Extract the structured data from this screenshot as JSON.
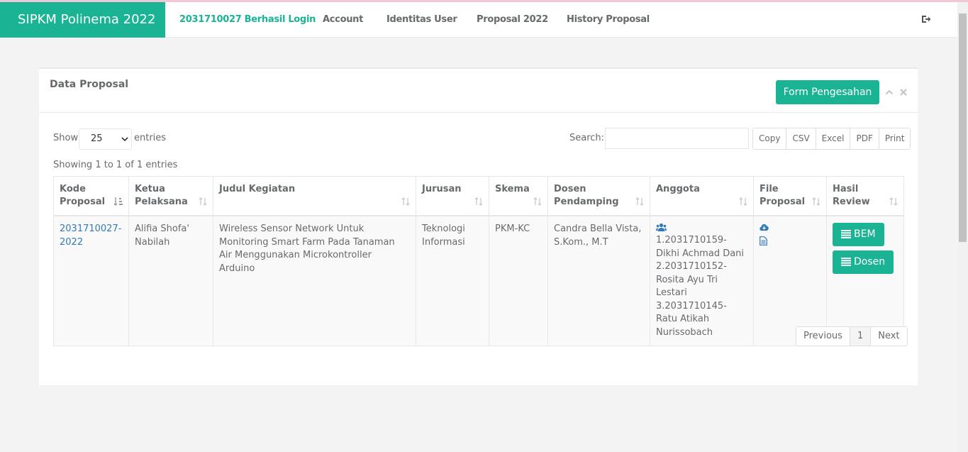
{
  "navbar": {
    "brand": "SIPKM Polinema 2022",
    "login_status": "2031710027 Berhasil Login",
    "items": [
      {
        "label": "Account"
      },
      {
        "label": "Identitas User"
      },
      {
        "label": "Proposal 2022"
      },
      {
        "label": "History Proposal"
      }
    ],
    "logout_icon": "sign-out-icon"
  },
  "panel": {
    "title": "Data Proposal",
    "form_button": "Form Pengesahan",
    "collapse_icon": "chevron-up-icon",
    "close_icon": "close-icon"
  },
  "table_controls": {
    "show_label": "Show",
    "page_size": "25",
    "entries_label": "entries",
    "search_label": "Search:",
    "search_value": "",
    "export_buttons": [
      "Copy",
      "CSV",
      "Excel",
      "PDF",
      "Print"
    ],
    "info": "Showing 1 to 1 of 1 entries"
  },
  "table": {
    "headers": [
      "Kode Proposal",
      "Ketua Pelaksana",
      "Judul Kegiatan",
      "Jurusan",
      "Skema",
      "Dosen Pendamping",
      "Anggota",
      "File Proposal",
      "Hasil Review"
    ],
    "rows": [
      {
        "kode": "2031710027-2022",
        "ketua": "Alifia Shofa' Nabilah",
        "judul": "Wireless Sensor Network Untuk Monitoring Smart Farm Pada Tanaman Air Menggunakan Microkontroller Arduino",
        "jurusan": "Teknologi Informasi",
        "skema": "PKM-KC",
        "dosen": "Candra Bella Vista, S.Kom., M.T",
        "anggota": [
          "1.2031710159-Dikhi Achmad Dani",
          "2.2031710152-Rosita Ayu Tri Lestari",
          "3.2031710145-Ratu Atikah Nurissobach"
        ],
        "review_buttons": [
          "BEM",
          "Dosen"
        ]
      }
    ]
  },
  "pagination": {
    "previous": "Previous",
    "current": "1",
    "next": "Next"
  },
  "colors": {
    "accent": "#1ab394",
    "link": "#337ab7",
    "text": "#676a6c"
  }
}
